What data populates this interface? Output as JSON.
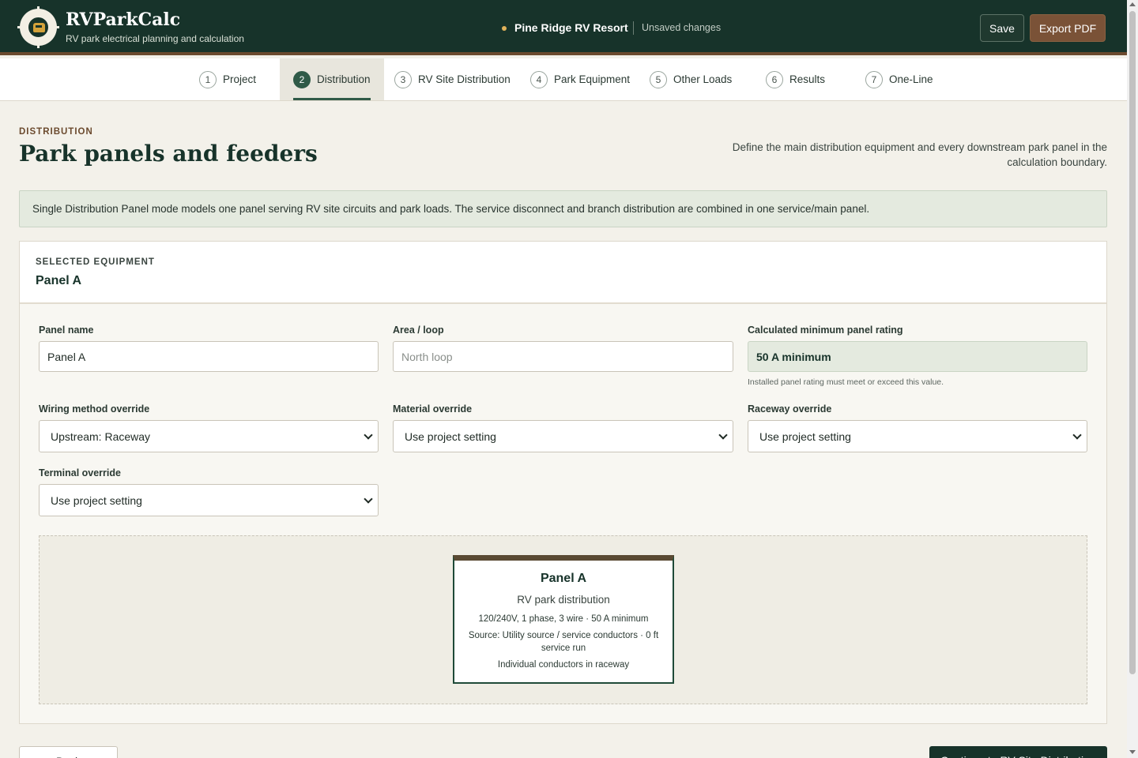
{
  "app": {
    "name": "RVParkCalc",
    "tagline": "RV park electrical planning and calculation",
    "logo_icon": "rv-target-icon"
  },
  "project": {
    "name": "Pine Ridge RV Resort",
    "status": "Unsaved changes",
    "status_dot_color": "#e0b25a"
  },
  "toolbar": {
    "save_label": "Save",
    "export_label": "Export PDF"
  },
  "steps": [
    {
      "num": "1",
      "label": "Project"
    },
    {
      "num": "2",
      "label": "Distribution",
      "active": true
    },
    {
      "num": "3",
      "label": "RV Site Distribution"
    },
    {
      "num": "4",
      "label": "Park Equipment"
    },
    {
      "num": "5",
      "label": "Other Loads"
    },
    {
      "num": "6",
      "label": "Results"
    },
    {
      "num": "7",
      "label": "One-Line"
    }
  ],
  "page": {
    "eyebrow": "DISTRIBUTION",
    "title": "Park panels and feeders",
    "description": "Define the main distribution equipment and every downstream park panel in the calculation boundary."
  },
  "notice": "Single Distribution Panel mode models one panel serving RV site circuits and park loads. The service disconnect and branch distribution are combined in one service/main panel.",
  "equipment": {
    "eyebrow": "SELECTED EQUIPMENT",
    "title": "Panel A",
    "fields": {
      "panel_name": {
        "label": "Panel name",
        "value": "Panel A"
      },
      "area_loop": {
        "label": "Area / loop",
        "placeholder": "North loop"
      },
      "min_rating": {
        "label": "Calculated minimum panel rating",
        "value": "50 A minimum",
        "hint": "Installed panel rating must meet or exceed this value."
      },
      "wiring_method": {
        "label": "Wiring method override",
        "value": "Upstream: Raceway"
      },
      "material": {
        "label": "Material override",
        "value": "Use project setting"
      },
      "raceway": {
        "label": "Raceway override",
        "value": "Use project setting"
      },
      "terminal": {
        "label": "Terminal override",
        "value": "Use project setting"
      }
    }
  },
  "diagram": {
    "title": "Panel A",
    "subtitle": "RV park distribution",
    "line1": "120/240V, 1 phase, 3 wire · 50 A minimum",
    "line2": "Source: Utility source / service conductors · 0 ft service run",
    "line3": "Individual conductors in raceway"
  },
  "nav": {
    "back_label": "Back",
    "continue_label": "Continue to RV Site Distribution"
  },
  "colors": {
    "header_bg": "#17332a",
    "accent_brown": "#7a5237",
    "active_step": "#2f5a47",
    "notice_bg": "#e4eadf"
  }
}
